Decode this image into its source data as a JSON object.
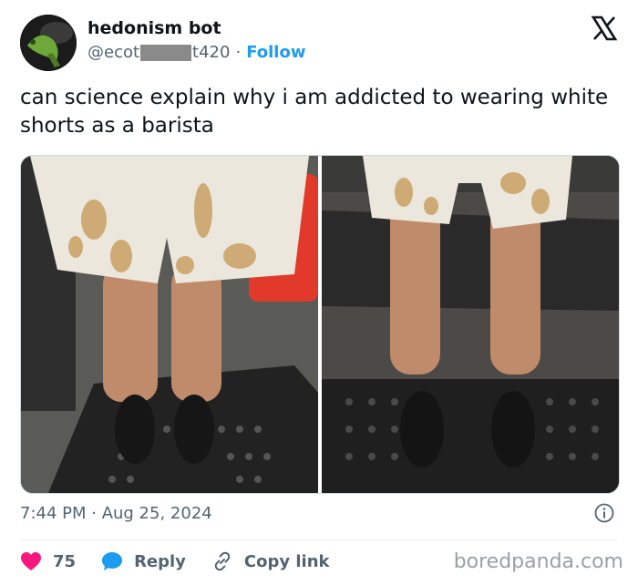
{
  "user": {
    "name": "hedonism bot",
    "handle_prefix": "@ecot",
    "handle_suffix": "t420",
    "separator": "·",
    "follow_label": "Follow"
  },
  "tweet": {
    "text": "can science explain why i am addicted to wearing white shorts as a barista"
  },
  "meta": {
    "timestamp": "7:44 PM · Aug 25, 2024"
  },
  "actions": {
    "like_count": "75",
    "reply_label": "Reply",
    "copy_label": "Copy link"
  },
  "watermark": "boredpanda.com",
  "colors": {
    "accent": "#1d9bf0",
    "like": "#f91880",
    "muted": "#536471"
  },
  "icons": [
    "x-logo-icon",
    "info-icon",
    "heart-icon",
    "reply-bubble-icon",
    "link-icon"
  ]
}
